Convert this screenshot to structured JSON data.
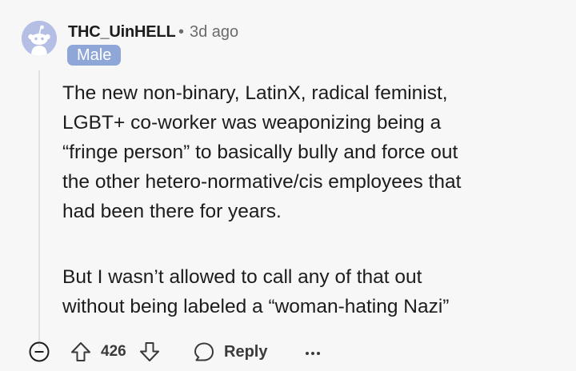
{
  "comment": {
    "username": "THC_UinHELL",
    "separator": "•",
    "timestamp": "3d ago",
    "flair": "Male",
    "paragraphs": [
      {
        "lines": [
          "The new non-binary, LatinX, radical feminist,",
          "LGBT+ co-worker was weaponizing being a",
          "“fringe person” to basically bully and force out",
          "the other hetero-normative/cis employees that",
          "had been there for years."
        ]
      },
      {
        "lines": [
          "But I wasn’t allowed to call any of that out",
          "without being labeled a “woman-hating Nazi”"
        ]
      }
    ]
  },
  "actions": {
    "score": "426",
    "reply_label": "Reply",
    "icons": {
      "collapse": "collapse-minus-icon",
      "upvote": "upvote-arrow-icon",
      "downvote": "downvote-arrow-icon",
      "reply": "speech-bubble-icon",
      "more": "more-options-icon"
    }
  },
  "colors": {
    "background": "#f7f7f7",
    "avatar": "#b5bfe6",
    "flair_bg": "#8fa6d9",
    "flair_text": "#ffffff",
    "text": "#1c1c1c",
    "muted": "#6b6b6b",
    "thread_line": "#e1e1e1"
  }
}
